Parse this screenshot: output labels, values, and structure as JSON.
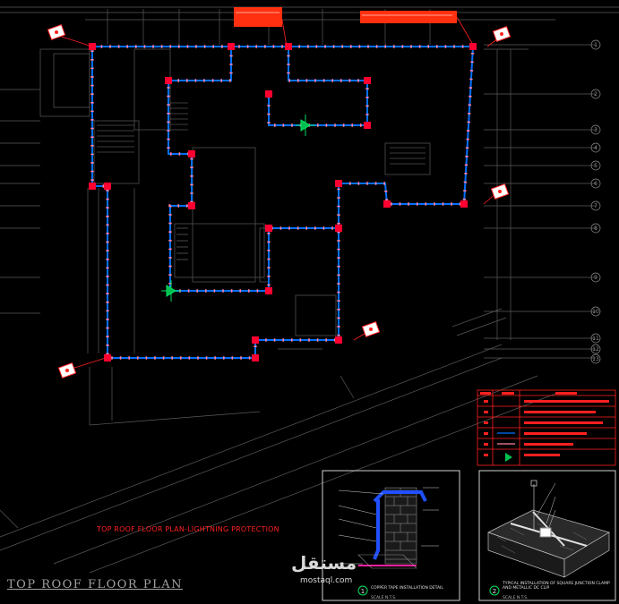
{
  "drawing": {
    "main_title": "TOP ROOF FLOOR PLAN-LIGHTNING PROTECTION",
    "plan_title": "TOP ROOF FLOOR PLAN",
    "grid_labels": [
      "1",
      "2",
      "3",
      "4",
      "5",
      "6",
      "7",
      "8",
      "9",
      "10",
      "11",
      "12",
      "13"
    ],
    "detail_1": {
      "number": "1",
      "caption": "COPPER TAPE INSTALLATION DETAIL",
      "scale": "SCALE N.T.S."
    },
    "detail_2": {
      "number": "2",
      "caption": "TYPICAL INSTALLATION OF SQUARE JUNCTION CLAMP AND METALLIC DC CLIP",
      "scale": "SCALE N.T.S."
    }
  },
  "watermark": {
    "arabic": "مستقل",
    "latin": "mostaql.com"
  },
  "colors": {
    "conductor": "#0070ff",
    "clip": "#ff80a0",
    "junction": "#ff0030",
    "air_terminal": "#00e060",
    "background": "#000000"
  }
}
